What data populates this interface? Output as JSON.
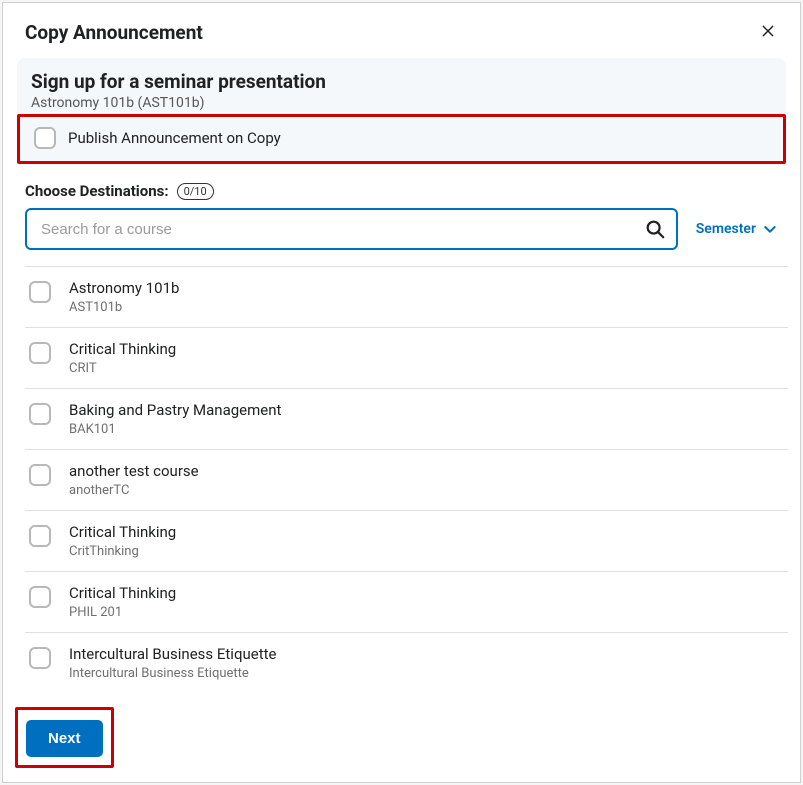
{
  "dialog": {
    "title": "Copy Announcement"
  },
  "announcement": {
    "title": "Sign up for a seminar presentation",
    "subtitle": "Astronomy 101b (AST101b)",
    "publish_label": "Publish Announcement on Copy"
  },
  "destinations": {
    "label": "Choose Destinations:",
    "count": "0/10"
  },
  "search": {
    "placeholder": "Search for a course"
  },
  "filter": {
    "label": "Semester"
  },
  "courses": [
    {
      "name": "Astronomy 101b",
      "code": "AST101b"
    },
    {
      "name": "Critical Thinking",
      "code": "CRIT"
    },
    {
      "name": "Baking and Pastry Management",
      "code": "BAK101"
    },
    {
      "name": "another test course",
      "code": "anotherTC"
    },
    {
      "name": "Critical Thinking",
      "code": "CritThinking"
    },
    {
      "name": "Critical Thinking",
      "code": "PHIL 201"
    },
    {
      "name": "Intercultural Business Etiquette",
      "code": "Intercultural Business Etiquette"
    }
  ],
  "footer": {
    "next_label": "Next"
  }
}
